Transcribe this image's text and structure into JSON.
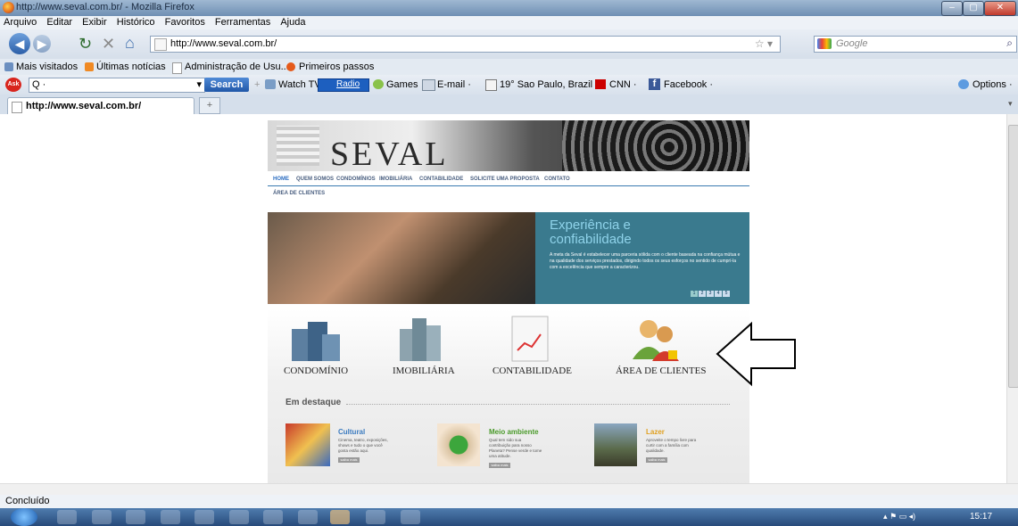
{
  "window": {
    "title": "http://www.seval.com.br/ - Mozilla Firefox",
    "controls": [
      "‒",
      "▢",
      "✕"
    ]
  },
  "menu": [
    "Arquivo",
    "Editar",
    "Exibir",
    "Histórico",
    "Favoritos",
    "Ferramentas",
    "Ajuda"
  ],
  "navigation": {
    "url": "http://www.seval.com.br/",
    "search_placeholder": "Google"
  },
  "bookmarks": [
    "Mais visitados",
    "Últimas notícias",
    "Administração de Usu...",
    "Primeiros passos"
  ],
  "ask_toolbar": {
    "search_field": "Q ·",
    "search_button": "Search",
    "items": [
      "Watch TV",
      "Radio",
      "Games",
      "E-mail ·",
      "19° Sao Paulo, Brazil ·",
      "CNN ·",
      "Facebook ·"
    ],
    "options": "Options ·"
  },
  "tab": {
    "label": "http://www.seval.com.br/",
    "new_tab": "+"
  },
  "site": {
    "logo": "SEVAL",
    "nav": [
      "HOME",
      "QUEM SOMOS",
      "CONDOMÍNIOS",
      "IMOBILIÁRIA",
      "CONTABILIDADE",
      "SOLICITE UMA PROPOSTA",
      "CONTATO",
      "ÁREA DE CLIENTES"
    ],
    "hero": {
      "title_line1": "Experiência e",
      "title_line2": "confiabilidade",
      "text": "A meta da Seval é estabelecer uma parceria sólida com o cliente baseada na confiança mútua e na qualidade dos serviços prestados, dirigindo todos os seus esforços no sentido de cumprí-la com a excelência que sempre a caracterizou.",
      "pages": [
        "1",
        "2",
        "3",
        "4",
        "5"
      ]
    },
    "services": [
      "CONDOMÍNIO",
      "IMOBILIÁRIA",
      "CONTABILIDADE",
      "ÁREA DE CLIENTES"
    ],
    "destaque": "Em destaque",
    "features": [
      {
        "title": "Cultural",
        "color": "#3a7abf",
        "text": "Cinema, teatro, exposições, shows e tudo o que você gosta estão aqui.",
        "button": "saiba mais"
      },
      {
        "title": "Meio ambiente",
        "color": "#4a9a2a",
        "text": "Qual tem sido sua contribuição para nosso Planeta? Pense verde e tome uma atitude.",
        "button": "saiba mais"
      },
      {
        "title": "Lazer",
        "color": "#e0a020",
        "text": "Aproveite o tempo livre para curtir com a família com qualidade.",
        "button": "saiba mais"
      }
    ]
  },
  "status": "Concluído",
  "clock": "15:17"
}
